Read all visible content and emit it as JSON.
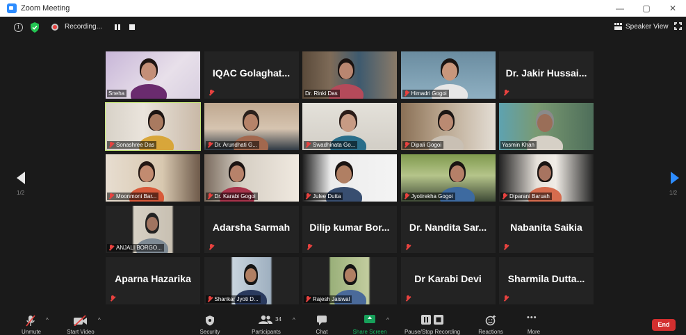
{
  "window": {
    "title": "Zoom Meeting",
    "minimize": "—",
    "restore": "▢",
    "close": "✕"
  },
  "topbar": {
    "info": "i",
    "recording": "Recording...",
    "speaker_view": "Speaker View"
  },
  "pagination": {
    "left": "1/2",
    "right": "1/2"
  },
  "participants": [
    {
      "name": "Sneha",
      "video": true,
      "muted": false,
      "active": false
    },
    {
      "name": "IQAC Golaghat...",
      "video": false,
      "muted": true,
      "active": false
    },
    {
      "name": "Dr. Rinki Das",
      "video": true,
      "muted": false,
      "active": false
    },
    {
      "name": "Himadri Gogoi",
      "video": true,
      "muted": true,
      "active": false
    },
    {
      "name": "Dr. Jakir Hussai...",
      "video": false,
      "muted": true,
      "active": false
    },
    {
      "name": "Sonashree Das",
      "video": true,
      "muted": true,
      "active": true
    },
    {
      "name": "Dr. Arundhati G...",
      "video": true,
      "muted": true,
      "active": false
    },
    {
      "name": "Swadhinata Go...",
      "video": true,
      "muted": true,
      "active": false
    },
    {
      "name": "Dipali Gogoi",
      "video": true,
      "muted": true,
      "active": false
    },
    {
      "name": "Yasmin Khan",
      "video": true,
      "muted": false,
      "active": false
    },
    {
      "name": "Moonmoni Bar...",
      "video": true,
      "muted": true,
      "active": false
    },
    {
      "name": "Dr. Karabi Gogoi",
      "video": true,
      "muted": true,
      "active": false
    },
    {
      "name": "Julee Dutta",
      "video": true,
      "muted": true,
      "active": false
    },
    {
      "name": "Jyotirekha Gogoi",
      "video": true,
      "muted": true,
      "active": false
    },
    {
      "name": "Diparani Baruah",
      "video": true,
      "muted": true,
      "active": false
    },
    {
      "name": "ANJALI BORGO...",
      "video": true,
      "muted": true,
      "active": false
    },
    {
      "name": "Adarsha Sarmah",
      "video": false,
      "muted": true,
      "active": false
    },
    {
      "name": "Dilip kumar Bor...",
      "video": false,
      "muted": true,
      "active": false
    },
    {
      "name": "Dr. Nandita Sar...",
      "video": false,
      "muted": true,
      "active": false
    },
    {
      "name": "Nabanita Saikia",
      "video": false,
      "muted": true,
      "active": false
    },
    {
      "name": "Aparna Hazarika",
      "video": false,
      "muted": true,
      "active": false
    },
    {
      "name": "Shankar Jyoti D...",
      "video": true,
      "muted": true,
      "active": false
    },
    {
      "name": "Rajesh Jaiswal",
      "video": true,
      "muted": true,
      "active": false
    },
    {
      "name": "Dr Karabi Devi",
      "video": false,
      "muted": true,
      "active": false
    },
    {
      "name": "Sharmila Dutta...",
      "video": false,
      "muted": true,
      "active": false
    }
  ],
  "toolbar": {
    "unmute": "Unmute",
    "start_video": "Start Video",
    "security": "Security",
    "participants": "Participants",
    "participants_count": "34",
    "chat": "Chat",
    "share_screen": "Share Screen",
    "pause_recording": "Pause/Stop Recording",
    "reactions": "Reactions",
    "more": "More",
    "more_glyph": "•••",
    "caret": "^",
    "end": "End"
  },
  "colors": {
    "accent": "#2d8cff",
    "share": "#17a05a",
    "end": "#d32f2f",
    "muted": "#e8423f",
    "active_border": "#c7e87a"
  }
}
